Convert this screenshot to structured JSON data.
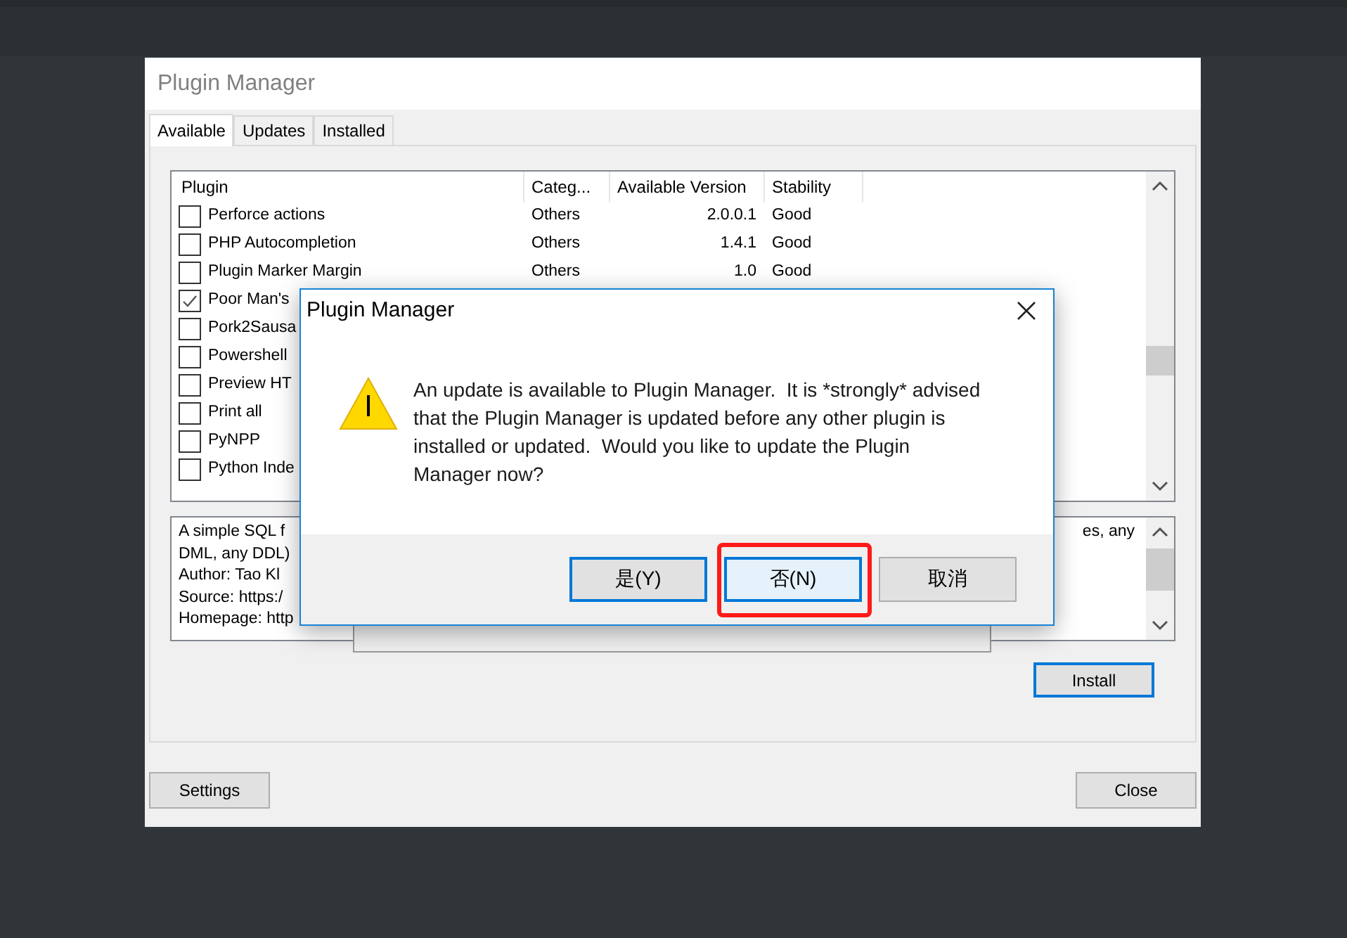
{
  "window": {
    "title": "Plugin Manager"
  },
  "tabs": [
    {
      "label": "Available",
      "selected": true
    },
    {
      "label": "Updates",
      "selected": false
    },
    {
      "label": "Installed",
      "selected": false
    }
  ],
  "table": {
    "columns": [
      "Plugin",
      "Categ...",
      "Available Version",
      "Stability"
    ],
    "rows": [
      {
        "checked": false,
        "plugin": "Perforce actions",
        "category": "Others",
        "version": "2.0.0.1",
        "stability": "Good"
      },
      {
        "checked": false,
        "plugin": "PHP Autocompletion",
        "category": "Others",
        "version": "1.4.1",
        "stability": "Good"
      },
      {
        "checked": false,
        "plugin": "Plugin Marker Margin",
        "category": "Others",
        "version": "1.0",
        "stability": "Good"
      },
      {
        "checked": true,
        "plugin": "Poor Man's"
      },
      {
        "checked": false,
        "plugin": "Pork2Sausa"
      },
      {
        "checked": false,
        "plugin": "Powershell"
      },
      {
        "checked": false,
        "plugin": "Preview HT"
      },
      {
        "checked": false,
        "plugin": "Print all"
      },
      {
        "checked": false,
        "plugin": "PyNPP"
      },
      {
        "checked": false,
        "plugin": "Python Inde"
      }
    ]
  },
  "description": {
    "lines": [
      {
        "text": "A simple SQL f",
        "tail": "es, any"
      },
      {
        "text": "DML, any DDL)"
      },
      {
        "text": "Author: Tao Kl"
      },
      {
        "text": "Source: https:/"
      },
      {
        "text": "Homepage: http"
      }
    ]
  },
  "install_button": "Install",
  "footer_buttons": [
    "Settings",
    "Close"
  ],
  "dialog": {
    "title": "Plugin Manager",
    "message": "An update is available to Plugin Manager.  It is *strongly* advised that the Plugin Manager is updated before any other plugin is installed or updated.  Would you like to update the Plugin Manager now?",
    "buttons": [
      {
        "label": "是(Y)",
        "kind": "default",
        "highlighted": false
      },
      {
        "label": "否(N)",
        "kind": "focused",
        "highlighted": true
      },
      {
        "label": "取消",
        "kind": "normal",
        "highlighted": false
      }
    ]
  }
}
